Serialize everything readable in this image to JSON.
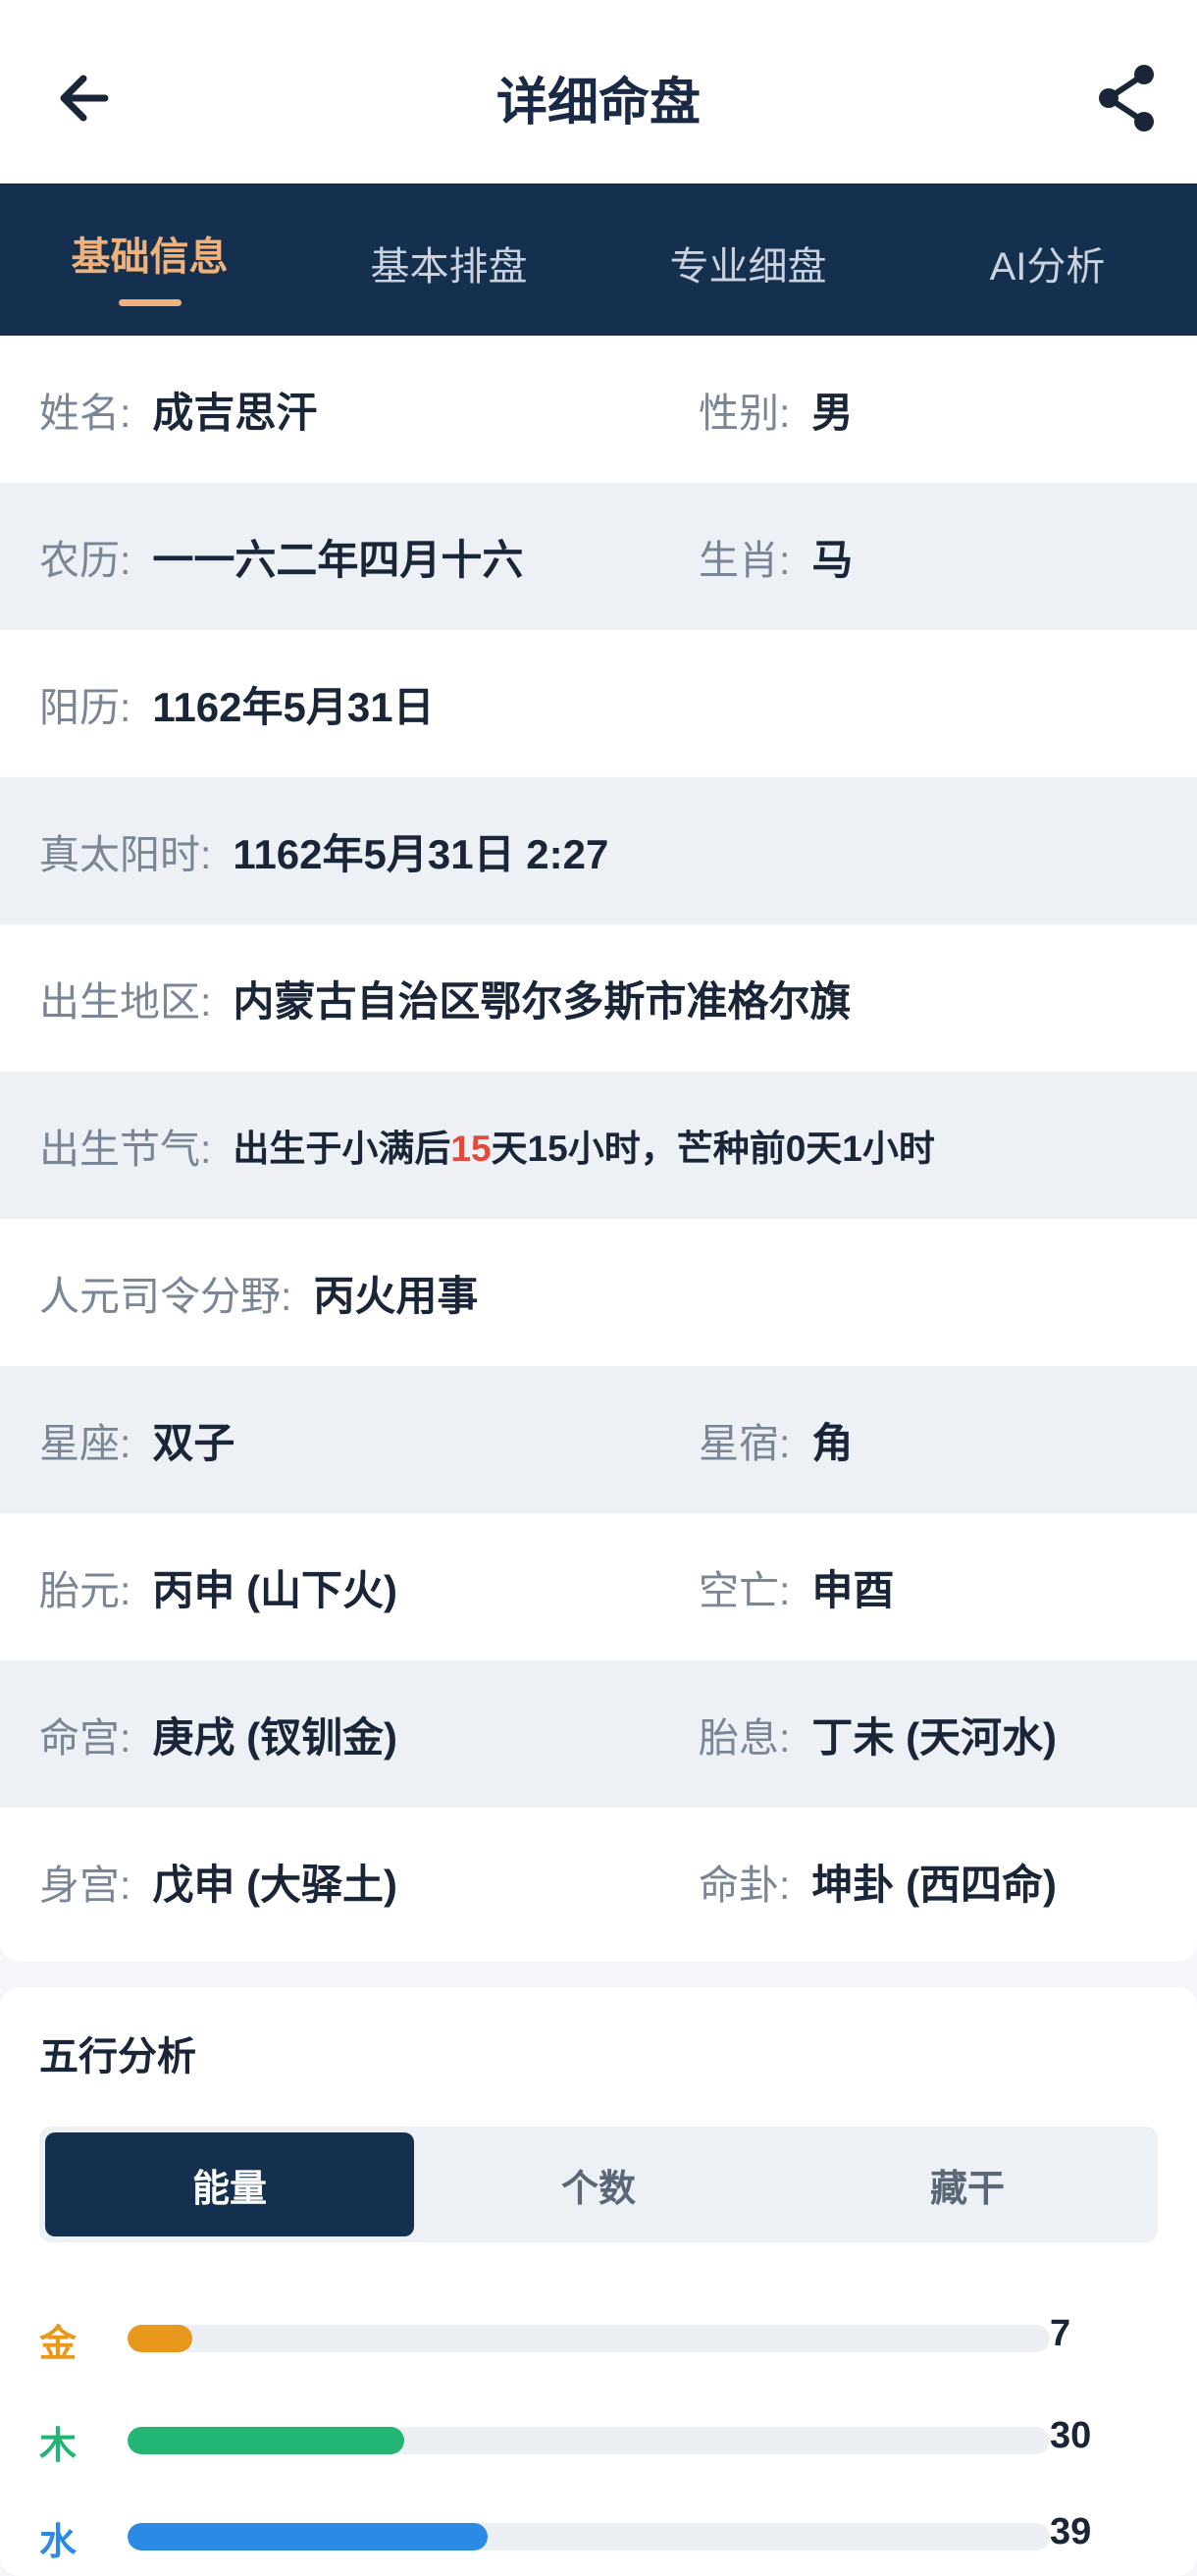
{
  "header": {
    "title": "详细命盘",
    "back_icon": "arrow-left-icon",
    "share_icon": "share-icon"
  },
  "tabs": [
    {
      "label": "基础信息",
      "active": true
    },
    {
      "label": "基本排盘",
      "active": false
    },
    {
      "label": "专业细盘",
      "active": false
    },
    {
      "label": "AI分析",
      "active": false
    }
  ],
  "info": {
    "name_label": "姓名:",
    "name": "成吉思汗",
    "gender_label": "性别:",
    "gender": "男",
    "lunar_label": "农历:",
    "lunar": "一一六二年四月十六",
    "zodiac_label": "生肖:",
    "zodiac": "马",
    "solar_label": "阳历:",
    "solar": "1162年5月31日",
    "true_solar_label": "真太阳时:",
    "true_solar": "1162年5月31日 2:27",
    "birthplace_label": "出生地区:",
    "birthplace": "内蒙古自治区鄂尔多斯市准格尔旗",
    "solar_term_label": "出生节气:",
    "solar_term_prefix": "出生于小满后",
    "solar_term_days": "15",
    "solar_term_suffix": "天15小时，芒种前0天1小时",
    "renyuan_label": "人元司令分野:",
    "renyuan": "丙火用事",
    "constellation_label": "星座:",
    "constellation": "双子",
    "mansion_label": "星宿:",
    "mansion": "角",
    "taiyuan_label": "胎元:",
    "taiyuan": "丙申 (山下火)",
    "kongwang_label": "空亡:",
    "kongwang": "申酉",
    "minggong_label": "命宫:",
    "minggong": "庚戌 (钗钏金)",
    "taixi_label": "胎息:",
    "taixi": "丁未 (天河水)",
    "shengong_label": "身宫:",
    "shengong": "戊申 (大驿土)",
    "minggua_label": "命卦:",
    "minggua": "坤卦 (西四命)"
  },
  "wuxing": {
    "title": "五行分析",
    "segments": [
      {
        "label": "能量",
        "active": true
      },
      {
        "label": "个数",
        "active": false
      },
      {
        "label": "藏干",
        "active": false
      }
    ],
    "max": 100,
    "bars": [
      {
        "label": "金",
        "value": "7",
        "amount": 7,
        "color": "#e8981c"
      },
      {
        "label": "木",
        "value": "30",
        "amount": 30,
        "color": "#22b573"
      },
      {
        "label": "水",
        "value": "39",
        "amount": 39,
        "color": "#2a8ae6"
      }
    ]
  }
}
